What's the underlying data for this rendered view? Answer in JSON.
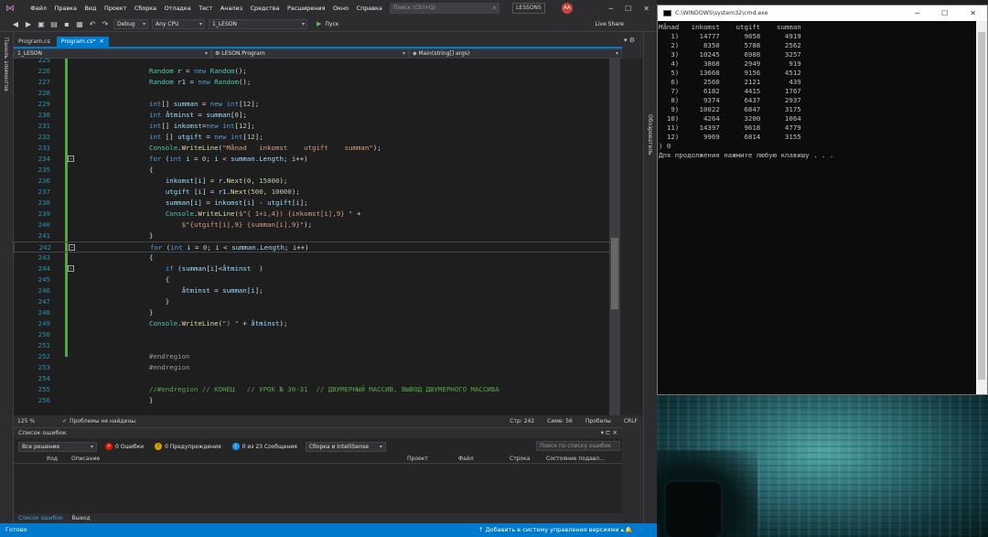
{
  "vs": {
    "menu": [
      "Файл",
      "Правка",
      "Вид",
      "Проект",
      "Сборка",
      "Отладка",
      "Тест",
      "Анализ",
      "Средства",
      "Расширения",
      "Окно",
      "Справка"
    ],
    "search_placeholder": "Поиск (Ctrl+Q)",
    "project_name": "LESSON5",
    "avatar": "AA",
    "toolbar": {
      "config": "Debug",
      "platform": "Any CPU",
      "startup": "1_LESON",
      "run_label": "Пуск",
      "live_share": "Live Share"
    },
    "left_strip_label": "Панель элементов",
    "right_strip_label": "Обозреватель",
    "tabs": [
      {
        "label": "Program.cs"
      },
      {
        "label": "Program.cs*"
      }
    ],
    "nav": {
      "project": "1_LESON",
      "class": "LESON.Program",
      "member": "Main(string[] args)"
    },
    "code_lines": [
      {
        "n": "225",
        "html": ""
      },
      {
        "n": "226",
        "html": "Random r = new Random();"
      },
      {
        "n": "227",
        "html": "Random r1 = new Random();"
      },
      {
        "n": "228",
        "html": ""
      },
      {
        "n": "229",
        "html": "int[] summan = new int[12];"
      },
      {
        "n": "230",
        "html": "int åtminst = summan[0];"
      },
      {
        "n": "231",
        "html": "int[] inkomst=new int[12];"
      },
      {
        "n": "232",
        "html": "int [] utgift = new int[12];"
      },
      {
        "n": "233",
        "html": "Console.WriteLine(\"Månad   inkomst    utgift    summan\");"
      },
      {
        "n": "234",
        "html": "for (int i = 0; i < summan.Length; i++)"
      },
      {
        "n": "235",
        "html": "{"
      },
      {
        "n": "236",
        "html": "    inkomst[i] = r.Next(0, 15000);"
      },
      {
        "n": "237",
        "html": "    utgift [i] = r1.Next(500, 10000);"
      },
      {
        "n": "238",
        "html": "    summan[i] = inkomst[i] - utgift[i];"
      },
      {
        "n": "239",
        "html": "    Console.WriteLine($\"{ 1+i,4}) {inkomst[i],9} \" +"
      },
      {
        "n": "240",
        "html": "        $\"{utgift[i],9} {summan[i],9}\");"
      },
      {
        "n": "241",
        "html": "}"
      },
      {
        "n": "242",
        "html": "for (int i = 0; i < summan.Length; i++)"
      },
      {
        "n": "243",
        "html": "{"
      },
      {
        "n": "244",
        "html": "    if (summan[i]<åtminst  )"
      },
      {
        "n": "245",
        "html": "    {"
      },
      {
        "n": "246",
        "html": "        åtminst = summan[i];"
      },
      {
        "n": "247",
        "html": "    }"
      },
      {
        "n": "248",
        "html": "}"
      },
      {
        "n": "249",
        "html": "Console.WriteLine(\") \" + åtminst);"
      },
      {
        "n": "250",
        "html": ""
      },
      {
        "n": "251",
        "html": ""
      },
      {
        "n": "252",
        "html": "#endregion"
      },
      {
        "n": "253",
        "html": "#endregion"
      },
      {
        "n": "254",
        "html": ""
      },
      {
        "n": "255",
        "html": "//#endregion // КОНЕЦ   // УРОК № 30-31  // ДВУМЕРНЫЙ МАССИВ, ВЫВОД ДВУМЕРНОГО МАССИВА"
      },
      {
        "n": "256",
        "html": "}"
      }
    ],
    "zoom": "125 %",
    "status_problems": "Проблемы не найдены.",
    "cursor": {
      "line": "Стр: 242",
      "col": "Симв: 56",
      "spaces": "Пробелы",
      "eol": "CRLF"
    },
    "error_list": {
      "title": "Список ошибок",
      "scope": "Все решение",
      "errors": "0 Ошибки",
      "warnings": "0 Предупреждения",
      "messages": "0 из 23 Сообщения",
      "build_filter": "Сборка и IntelliSense",
      "search_placeholder": "Поиск по списку ошибок",
      "columns": [
        "Код",
        "Описание",
        "Проект",
        "Файл",
        "Строка",
        "Состояние подавл..."
      ]
    },
    "bottom_tabs": [
      "Список ошибок",
      "Вывод"
    ],
    "statusbar": {
      "left": "Готово",
      "right": "Добавить в систему управления версиями"
    }
  },
  "console": {
    "title": "C:\\WINDOWS\\system32\\cmd.exe",
    "header": "Månad   inkomst    utgift    summan",
    "rows": [
      {
        "m": "1)",
        "inkomst": "14777",
        "utgift": "9858",
        "summan": "4919"
      },
      {
        "m": "2)",
        "inkomst": "8350",
        "utgift": "5788",
        "summan": "2562"
      },
      {
        "m": "3)",
        "inkomst": "10245",
        "utgift": "6988",
        "summan": "3257"
      },
      {
        "m": "4)",
        "inkomst": "3868",
        "utgift": "2949",
        "summan": "919"
      },
      {
        "m": "5)",
        "inkomst": "13668",
        "utgift": "9156",
        "summan": "4512"
      },
      {
        "m": "6)",
        "inkomst": "2560",
        "utgift": "2121",
        "summan": "439"
      },
      {
        "m": "7)",
        "inkomst": "6182",
        "utgift": "4415",
        "summan": "1767"
      },
      {
        "m": "8)",
        "inkomst": "9374",
        "utgift": "6437",
        "summan": "2937"
      },
      {
        "m": "9)",
        "inkomst": "10022",
        "utgift": "6847",
        "summan": "3175"
      },
      {
        "m": "10)",
        "inkomst": "4264",
        "utgift": "3200",
        "summan": "1064"
      },
      {
        "m": "11)",
        "inkomst": "14397",
        "utgift": "9618",
        "summan": "4779"
      },
      {
        "m": "12)",
        "inkomst": "9969",
        "utgift": "6814",
        "summan": "3155"
      }
    ],
    "result": ") 0",
    "prompt": "Для продолжения нажмите любую клавишу . . ."
  }
}
